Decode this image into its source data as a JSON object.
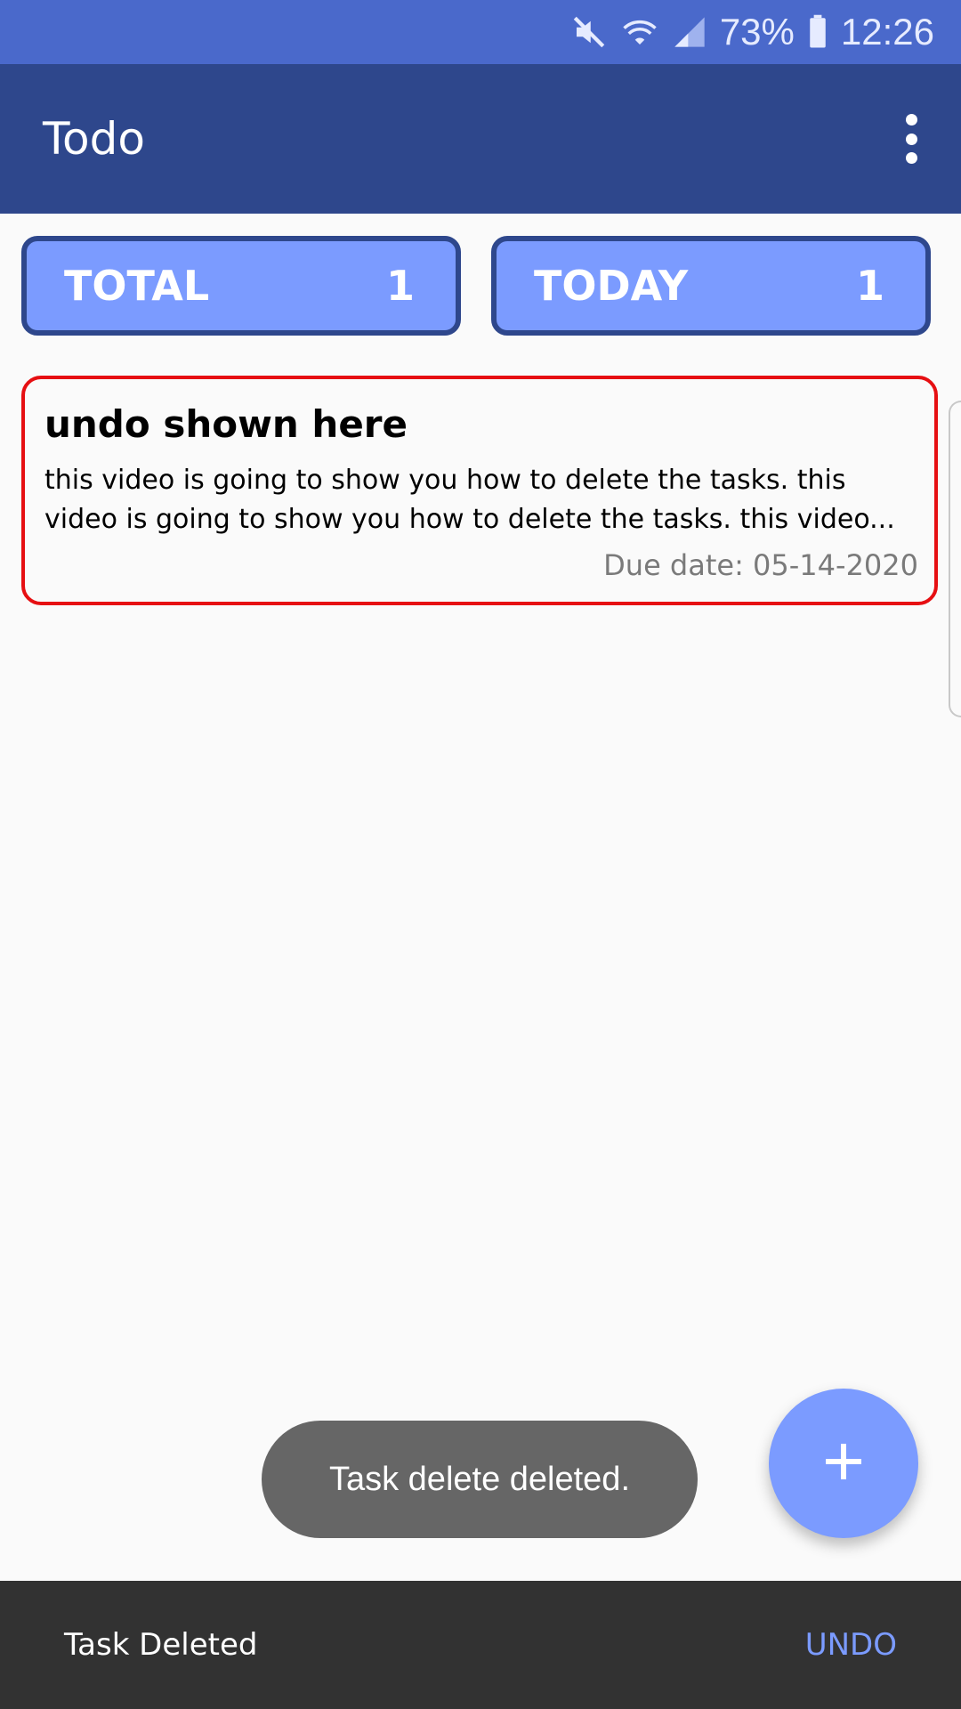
{
  "status_bar": {
    "battery": "73%",
    "time": "12:26"
  },
  "app_bar": {
    "title": "Todo"
  },
  "counters": {
    "total_label": "TOTAL",
    "total_value": "1",
    "today_label": "TODAY",
    "today_value": "1"
  },
  "task": {
    "title": "undo shown here",
    "description": "this video is going to show you how to delete the tasks. this video is going to show you how to delete the tasks. this video...",
    "due_date": "Due date: 05-14-2020"
  },
  "toast": {
    "message": "Task delete deleted."
  },
  "fab": {
    "icon": "plus-icon"
  },
  "snackbar": {
    "message": "Task Deleted",
    "action_label": "UNDO"
  },
  "colors": {
    "status_bar": "#4a69cb",
    "app_bar": "#2e478c",
    "accent": "#7b9bff",
    "task_border": "#e60f12"
  }
}
